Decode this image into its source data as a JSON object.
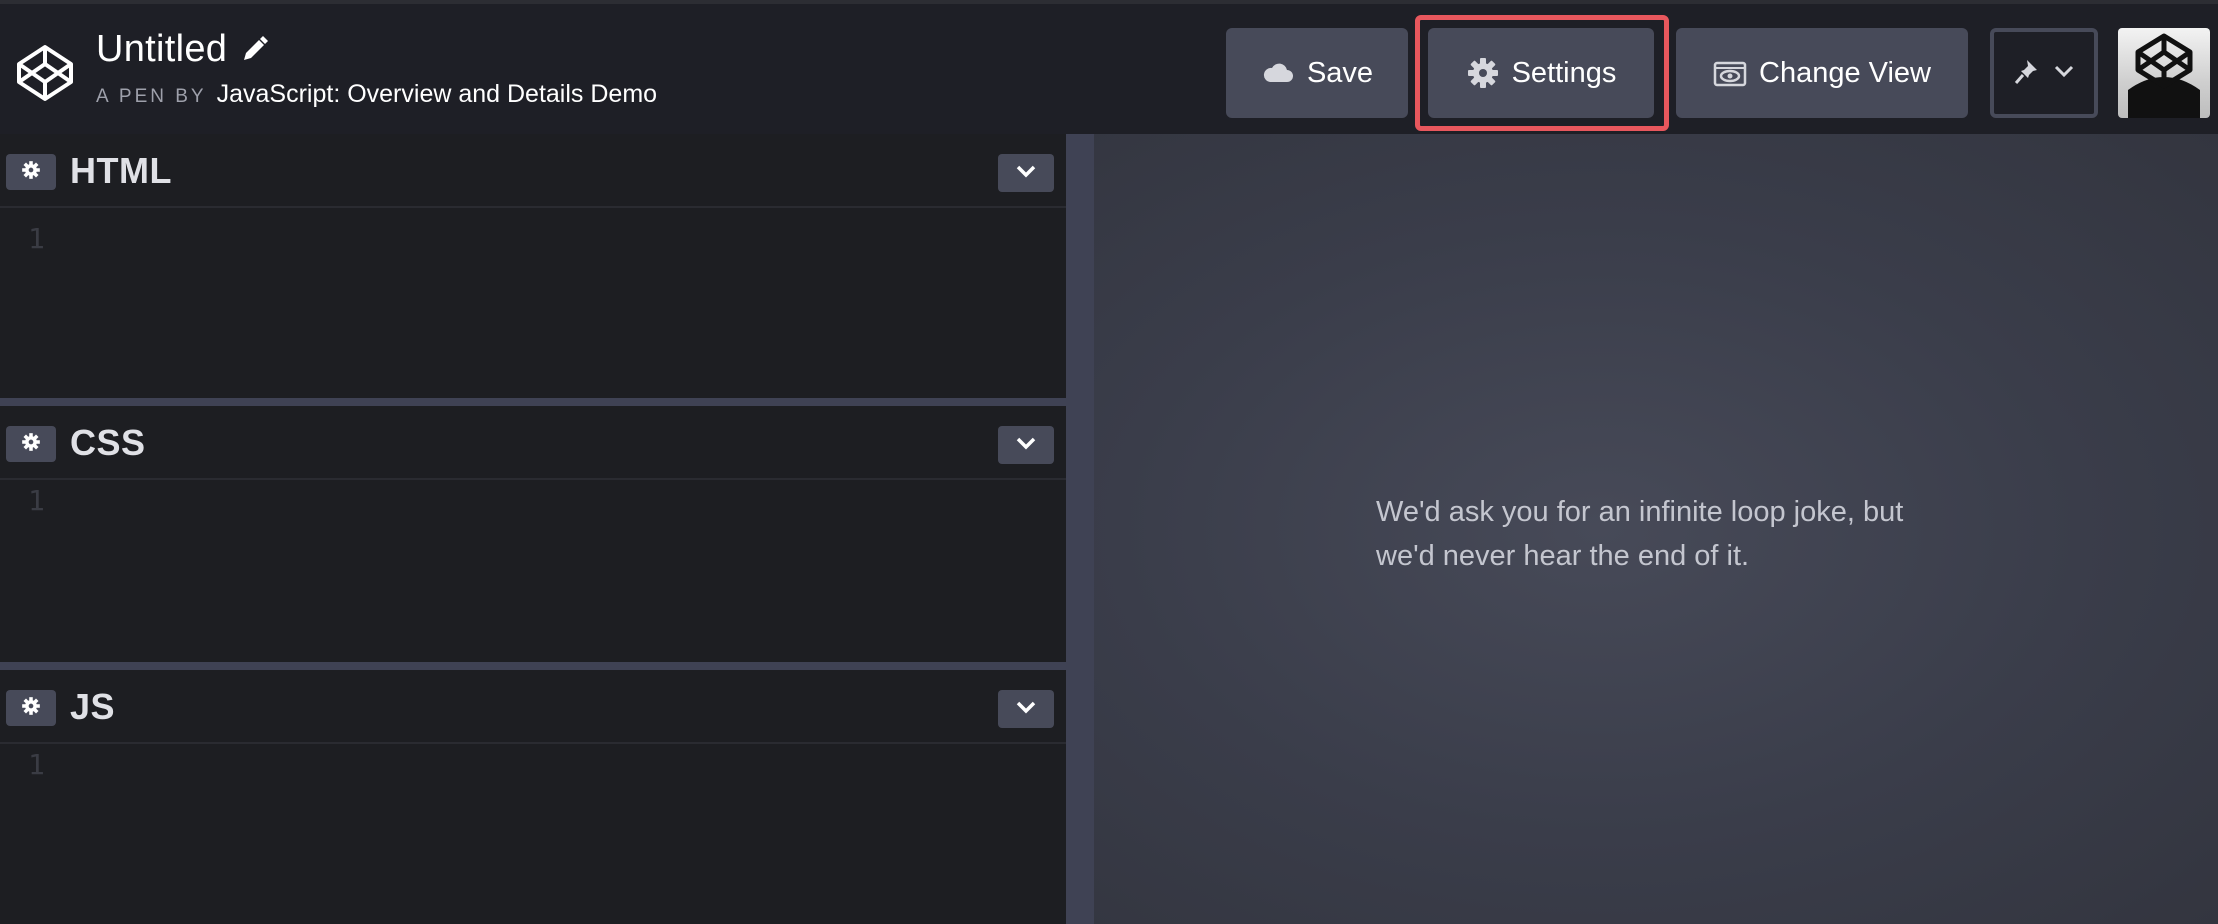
{
  "header": {
    "title": "Untitled",
    "byline_label": "A PEN BY",
    "author": "JavaScript: Overview and Details Demo"
  },
  "toolbar": {
    "save_label": "Save",
    "settings_label": "Settings",
    "change_view_label": "Change View"
  },
  "panels": [
    {
      "name": "HTML",
      "line_number": "1"
    },
    {
      "name": "CSS",
      "line_number": "1"
    },
    {
      "name": "JS",
      "line_number": "1"
    }
  ],
  "preview": {
    "message_line1": "We'd ask you for an infinite loop joke, but",
    "message_line2": "we'd never hear the end of it."
  },
  "colors": {
    "background": "#1e1f26",
    "button": "#474a59",
    "highlight": "#e8575d",
    "preview": "#3a3d4a"
  },
  "icons": [
    "codepen-logo-icon",
    "pencil-icon",
    "cloud-icon",
    "gear-icon",
    "eye-icon",
    "pin-icon",
    "chevron-down-icon"
  ]
}
